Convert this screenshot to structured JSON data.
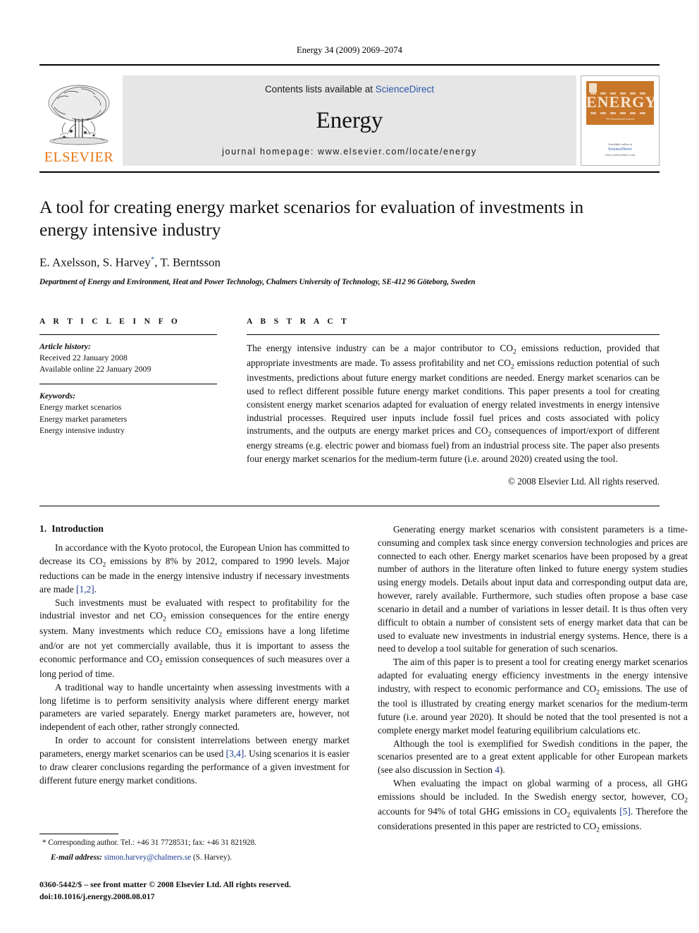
{
  "running_head": "Energy 34 (2009) 2069–2074",
  "banner": {
    "publisher_logo_text": "ELSEVIER",
    "contents_prefix": "Contents lists available at ",
    "contents_link": "ScienceDirect",
    "journal_name": "Energy",
    "homepage_line": "journal homepage: www.elsevier.com/locate/energy",
    "cover": {
      "title": "ENERGY",
      "subtitle": "The International Journal",
      "available_line": "Available online at",
      "sciencedirect": "ScienceDirect",
      "sd_url": "www.sciencedirect.com"
    }
  },
  "article": {
    "title": "A tool for creating energy market scenarios for evaluation of investments in energy intensive industry",
    "authors_pre": "E. Axelsson, S. Harvey",
    "authors_star": "*",
    "authors_post": ", T. Berntsson",
    "affiliation": "Department of Energy and Environment, Heat and Power Technology, Chalmers University of Technology, SE-412 96 Göteborg, Sweden"
  },
  "article_info": {
    "heading": "A R T I C L E    I N F O",
    "history_label": "Article history:",
    "history": [
      "Received 22 January 2008",
      "Available online 22 January 2009"
    ],
    "keywords_label": "Keywords:",
    "keywords": [
      "Energy market scenarios",
      "Energy market parameters",
      "Energy intensive industry"
    ]
  },
  "abstract": {
    "heading": "A B S T R A C T",
    "text_p1": "The energy intensive industry can be a major contributor to CO",
    "text_p2": " emissions reduction, provided that appropriate investments are made. To assess profitability and net CO",
    "text_p3": " emissions reduction potential of such investments, predictions about future energy market conditions are needed. Energy market scenarios can be used to reflect different possible future energy market conditions. This paper presents a tool for creating consistent energy market scenarios adapted for evaluation of energy related investments in energy intensive industrial processes. Required user inputs include fossil fuel prices and costs associated with policy instruments, and the outputs are energy market prices and CO",
    "text_p4": " consequences of import/export of different energy streams (e.g. electric power and biomass fuel) from an industrial process site. The paper also presents four energy market scenarios for the medium-term future (i.e. around 2020) created using the tool.",
    "copyright": "© 2008 Elsevier Ltd. All rights reserved."
  },
  "body": {
    "section_number": "1.",
    "section_title": "Introduction",
    "left_paragraphs": {
      "p1_a": "In accordance with the Kyoto protocol, the European Union has committed to decrease its CO",
      "p1_b": " emissions by 8% by 2012, compared to 1990 levels. Major reductions can be made in the energy intensive industry if necessary investments are made ",
      "p1_ref": "[1,2]",
      "p1_c": ".",
      "p2_a": "Such investments must be evaluated with respect to profitability for the industrial investor and net CO",
      "p2_b": " emission consequences for the entire energy system. Many investments which reduce CO",
      "p2_c": " emissions have a long lifetime and/or are not yet commercially available, thus it is important to assess the economic performance and CO",
      "p2_d": " emission consequences of such measures over a long period of time.",
      "p3": "A traditional way to handle uncertainty when assessing investments with a long lifetime is to perform sensitivity analysis where different energy market parameters are varied separately. Energy market parameters are, however, not independent of each other, rather strongly connected.",
      "p4_a": "In order to account for consistent interrelations between energy market parameters, energy market scenarios can be used ",
      "p4_ref": "[3,4]",
      "p4_b": ". Using scenarios it is easier to draw clearer conclusions regarding the performance of a given investment for different future energy market conditions."
    },
    "right_paragraphs": {
      "p1": "Generating energy market scenarios with consistent parameters is a time-consuming and complex task since energy conversion technologies and prices are connected to each other. Energy market scenarios have been proposed by a great number of authors in the literature often linked to future energy system studies using energy models. Details about input data and corresponding output data are, however, rarely available. Furthermore, such studies often propose a base case scenario in detail and a number of variations in lesser detail. It is thus often very difficult to obtain a number of consistent sets of energy market data that can be used to evaluate new investments in industrial energy systems. Hence, there is a need to develop a tool suitable for generation of such scenarios.",
      "p2_a": "The aim of this paper is to present a tool for creating energy market scenarios adapted for evaluating energy efficiency investments in the energy intensive industry, with respect to economic performance and CO",
      "p2_b": " emissions. The use of the tool is illustrated by creating energy market scenarios for the medium-term future (i.e. around year 2020). It should be noted that the tool presented is not a complete energy market model featuring equilibrium calculations etc.",
      "p3_a": "Although the tool is exemplified for Swedish conditions in the paper, the scenarios presented are to a great extent applicable for other European markets (see also discussion in Section ",
      "p3_ref": "4",
      "p3_b": ").",
      "p4_a": "When evaluating the impact on global warming of a process, all GHG emissions should be included. In the Swedish energy sector, however, CO",
      "p4_b": " accounts for 94% of total GHG emissions in CO",
      "p4_c": " equivalents ",
      "p4_ref": "[5]",
      "p4_d": ". Therefore the considerations presented in this paper are restricted to CO",
      "p4_e": " emissions."
    }
  },
  "footer": {
    "corresponding": "* Corresponding author. Tel.: +46 31 7728531; fax: +46 31 821928.",
    "email_label": "E-mail address:",
    "email": "simon.harvey@chalmers.se",
    "email_suffix": "(S. Harvey).",
    "issn_line": "0360-5442/$ – see front matter © 2008 Elsevier Ltd. All rights reserved.",
    "doi_line": "doi:10.1016/j.energy.2008.08.017"
  },
  "colors": {
    "link": "#1a3a8f",
    "elsevier_orange": "#e87511",
    "banner_grey": "#e6e6e6",
    "cover_orange": "#c8762a"
  }
}
